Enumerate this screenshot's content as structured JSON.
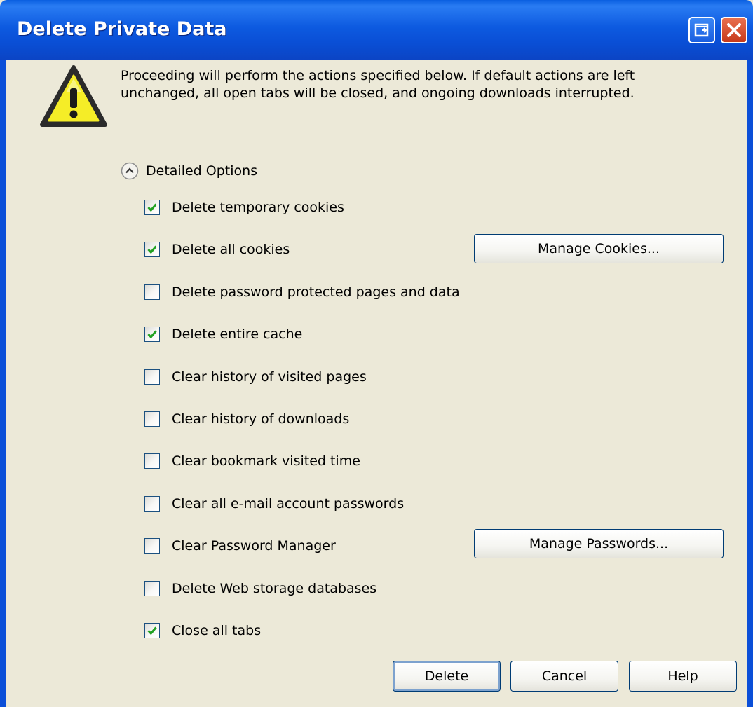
{
  "window": {
    "title": "Delete Private Data"
  },
  "message": {
    "line1": "Proceeding will perform the actions specified below. If default actions are left",
    "line2": "unchanged, all open tabs will be closed, and ongoing downloads interrupted."
  },
  "detailed_options": {
    "label": "Detailed Options",
    "expanded": true
  },
  "options": [
    {
      "label": "Delete temporary cookies",
      "checked": true
    },
    {
      "label": "Delete all cookies",
      "checked": true
    },
    {
      "label": "Delete password protected pages and data",
      "checked": false
    },
    {
      "label": "Delete entire cache",
      "checked": true
    },
    {
      "label": "Clear history of visited pages",
      "checked": false
    },
    {
      "label": "Clear history of downloads",
      "checked": false
    },
    {
      "label": "Clear bookmark visited time",
      "checked": false
    },
    {
      "label": "Clear all e-mail account passwords",
      "checked": false
    },
    {
      "label": "Clear Password Manager",
      "checked": false
    },
    {
      "label": "Delete Web storage databases",
      "checked": false
    },
    {
      "label": "Close all tabs",
      "checked": true
    }
  ],
  "side_buttons": {
    "manage_cookies": "Manage Cookies...",
    "manage_passwords": "Manage Passwords..."
  },
  "footer": {
    "delete": "Delete",
    "cancel": "Cancel",
    "help": "Help"
  },
  "colors": {
    "titlebar": "#0a4fd6",
    "dialog_bg": "#ece9d8",
    "check": "#21a121"
  }
}
